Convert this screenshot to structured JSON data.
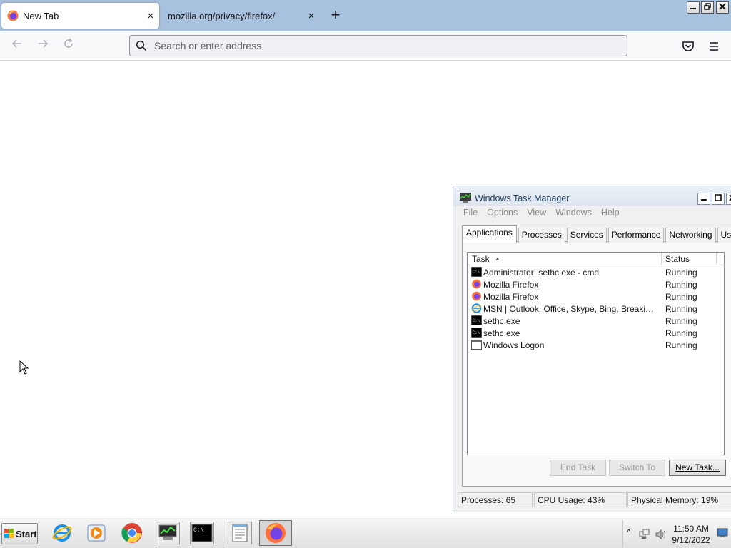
{
  "browser": {
    "tabs": [
      {
        "title": "New Tab",
        "active": true,
        "favicon": "firefox-icon"
      },
      {
        "title": "mozilla.org/privacy/firefox/",
        "active": false
      }
    ],
    "new_tab_symbol": "+",
    "close_symbol": "×",
    "url_placeholder": "Search or enter address",
    "url_value": ""
  },
  "task_manager": {
    "title": "Windows Task Manager",
    "menu": [
      "File",
      "Options",
      "View",
      "Windows",
      "Help"
    ],
    "tabs": [
      "Applications",
      "Processes",
      "Services",
      "Performance",
      "Networking",
      "Users"
    ],
    "selected_tab": "Applications",
    "columns": {
      "task": "Task",
      "status": "Status"
    },
    "rows": [
      {
        "icon": "cmd-icon",
        "task": "Administrator: sethc.exe - cmd",
        "status": "Running"
      },
      {
        "icon": "firefox-icon",
        "task": "Mozilla Firefox",
        "status": "Running"
      },
      {
        "icon": "firefox-icon",
        "task": "Mozilla Firefox",
        "status": "Running"
      },
      {
        "icon": "ie-icon",
        "task": "MSN | Outlook, Office, Skype, Bing, Breaking Ne...",
        "status": "Running"
      },
      {
        "icon": "cmd-icon",
        "task": "sethc.exe",
        "status": "Running"
      },
      {
        "icon": "cmd-icon",
        "task": "sethc.exe",
        "status": "Running"
      },
      {
        "icon": "window-icon",
        "task": "Windows Logon",
        "status": "Running"
      }
    ],
    "buttons": {
      "end_task": "End Task",
      "switch_to": "Switch To",
      "new_task": "New Task..."
    },
    "status": {
      "processes": "Processes: 65",
      "cpu": "CPU Usage: 43%",
      "memory": "Physical Memory: 19%"
    }
  },
  "taskbar": {
    "start_label": "Start",
    "clock_time": "11:50 AM",
    "clock_date": "9/12/2022",
    "pinned": [
      "ie-icon",
      "media-player-icon",
      "chrome-icon",
      "task-manager-icon",
      "cmd-icon",
      "notepad-icon",
      "firefox-icon"
    ]
  },
  "colors": {
    "tabstrip": "#a8c1de",
    "taskbar": "#e6e6e6"
  }
}
